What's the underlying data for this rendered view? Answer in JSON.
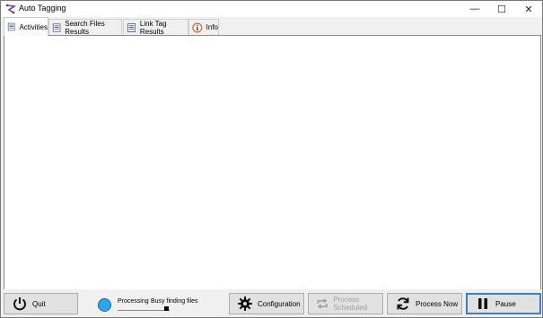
{
  "window": {
    "title": "Auto Tagging",
    "controls": {
      "minimize": "—",
      "maximize": "☐",
      "close": "✕"
    }
  },
  "tabs": [
    {
      "label": "Activities",
      "icon": "document-list-icon",
      "active": true
    },
    {
      "label": "Search Files Results",
      "icon": "document-list-icon",
      "active": false
    },
    {
      "label": "Link Tag Results",
      "icon": "document-list-icon",
      "active": false
    },
    {
      "label": "Info",
      "icon": "info-icon",
      "active": false
    }
  ],
  "footer": {
    "quit_label": "Quit",
    "status": {
      "label": "Processing",
      "text": "Busy finding files",
      "color": "#2aa7ee"
    },
    "configuration_label": "Configuration",
    "process_scheduled_label": "Process Scheduled",
    "process_now_label": "Process Now",
    "pause_label": "Pause"
  },
  "colors": {
    "accent": "#3b7ddd",
    "status": "#2aa7ee",
    "info_icon": "#e8682a"
  }
}
